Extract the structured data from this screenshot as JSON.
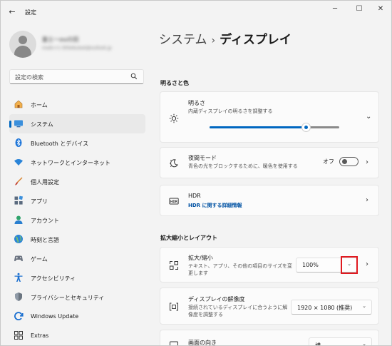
{
  "window": {
    "title": "設定",
    "controls": {
      "minimize": "─",
      "maximize": "☐",
      "close": "✕"
    },
    "back": "←"
  },
  "profile": {
    "name": "富士ーouの田",
    "email": "msdn+1-300e6utest@outlook.jp"
  },
  "search": {
    "placeholder": "設定の検索"
  },
  "nav": {
    "items": [
      {
        "label": "ホーム",
        "icon": "home-icon"
      },
      {
        "label": "システム",
        "icon": "system-icon",
        "selected": true
      },
      {
        "label": "Bluetooth とデバイス",
        "icon": "bluetooth-icon"
      },
      {
        "label": "ネットワークとインターネット",
        "icon": "network-icon"
      },
      {
        "label": "個人用設定",
        "icon": "brush-icon"
      },
      {
        "label": "アプリ",
        "icon": "apps-icon"
      },
      {
        "label": "アカウント",
        "icon": "account-icon"
      },
      {
        "label": "時刻と言語",
        "icon": "time-language-icon"
      },
      {
        "label": "ゲーム",
        "icon": "game-icon"
      },
      {
        "label": "アクセシビリティ",
        "icon": "accessibility-icon"
      },
      {
        "label": "プライバシーとセキュリティ",
        "icon": "shield-icon"
      },
      {
        "label": "Windows Update",
        "icon": "update-icon"
      },
      {
        "label": "Extras",
        "icon": "extras-icon"
      }
    ]
  },
  "breadcrumb": {
    "parent": "システム",
    "separator": "›",
    "current": "ディスプレイ"
  },
  "sections": {
    "brightness_color": "明るさと色",
    "scale_layout": "拡大縮小とレイアウト"
  },
  "brightness": {
    "title": "明るさ",
    "desc": "内蔵ディスプレイの明るさを調整する",
    "value": 0.74
  },
  "night_light": {
    "title": "夜間モード",
    "desc": "青色の光をブロックするために、暖色を使用する",
    "state": "オフ"
  },
  "hdr": {
    "title": "HDR",
    "link": "HDR に関する詳細情報"
  },
  "scale": {
    "title": "拡大/縮小",
    "desc_line1": "テキスト、アプリ、その他の項目のサイズを変",
    "desc_line2": "更します",
    "value": "100%"
  },
  "resolution": {
    "title": "ディスプレイの解像度",
    "desc_line1": "接続されているディスプレイに合うように解",
    "desc_line2": "像度を調整する",
    "value": "1920 × 1080 (推奨)"
  },
  "orientation": {
    "title": "画面の向き",
    "value": "横"
  },
  "colors": {
    "accent": "#0067c0",
    "highlight": "#e0191f"
  }
}
